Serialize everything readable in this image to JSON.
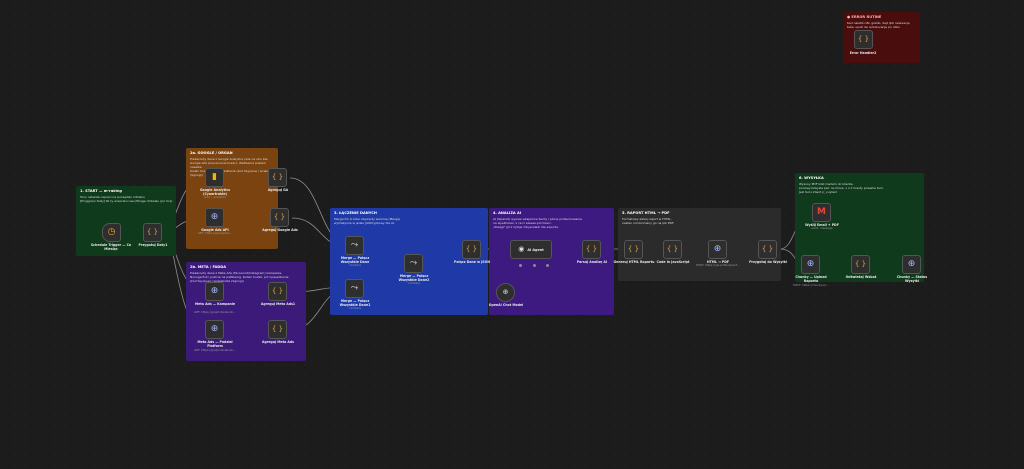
{
  "groups": {
    "error": {
      "title": "● ERROR RUTINE",
      "desc": "Kad naletiš n8n greški, dajt ljidi rešavanje\nteše, uputi da reduzovanje po obliu",
      "color": "#4a0d0d"
    },
    "start": {
      "title": "1. START — m-raking",
      "desc": "Tono rabante capreci na punepdan intrabiu\n[Pruggiran Daty] Pe ty eraecetu neur/Pnege ntrbalau (pri bra)",
      "color": "#0f3a1c"
    },
    "google": {
      "title": "2a. GOOGLE / ORGAN",
      "desc": "Prekarouty dane z Google Analytics (wie na obu bia,\nGoogle Ads (nevuocenie kozac), WabSema (swazic nasalka.\nKodan tvalkó, prt npesedkanie (kod Ssyrpoe) i wrapskreta (Sgnogi)",
      "color": "#7a4310"
    },
    "meta": {
      "title": "2b. META / FADDA",
      "desc": "Prekarouty dane z Meta Ads (Faceocod/Instagram) kampanie,\nNonogerfull i pozicie na pattbemg. Kodan tvalkó, prt npesedkanie\n(kod Ssyrpoe) i wrapskreta (Sgnogi)",
      "color": "#3b1a7a"
    },
    "merge": {
      "title": "3. ŁĄCZENIE DANYCH",
      "desc": "Mergochó lo bibe obywarty waronie (Merge)\nwyzdatycze w jeden JSON gotowy dla AI.",
      "color": "#1f3aa6"
    },
    "ai": {
      "title": "4. ANALIZA AI",
      "desc": "AI (OpenAI) wyowa wzajemne Sonty i plona podsumowanie\nna wyekholex, z ce tr szesse.prz tivarc.\n„Pszegl\" (prz njdoje mbyeraledi ste exports.",
      "color": "#3c1a80"
    },
    "report": {
      "title": "5. RAPORT HTML → PDF",
      "desc": "Formatowy kaleq raport w HTML,\nnastan omdonmany go na plk PDF.",
      "color": "#2b2b2b"
    },
    "send": {
      "title": "6. WYSYŁKA",
      "desc": "Wysvoy PDF kilst mailem do klienta,\nponowymiwysla pat: na Drive, x z z Cresty powwlie tem.\nJezi turio klient jr_vuytenł",
      "color": "#0f3a1c"
    }
  },
  "nodes": {
    "error_handler": {
      "label": "Error Handler2",
      "sub": ""
    },
    "schedule": {
      "label": "Schedule Trigger — Co Miesiąc",
      "sub": ""
    },
    "prep": {
      "label": "Przygotuj Daty1",
      "sub": ""
    },
    "ga": {
      "label": "Google Analytics (Cyaartraide)",
      "sub": "GA4 • analytics"
    },
    "ga_agg": {
      "label": "Agreguj GA",
      "sub": ""
    },
    "gads": {
      "label": "Google Ads API",
      "sub": "GET: https://googleads…"
    },
    "gads_agg": {
      "label": "Agreguj Google Ads",
      "sub": ""
    },
    "meta1": {
      "label": "Meta Ads — Kampanie",
      "sub": "GET: https://graph.facebook…"
    },
    "meta1_agg": {
      "label": "Agreguj Meta Ads1",
      "sub": ""
    },
    "meta2": {
      "label": "Meta Ads — Podział Platform",
      "sub": "GET: https://graph.facebook…"
    },
    "meta2_agg": {
      "label": "Agreguj Meta Ads",
      "sub": ""
    },
    "merge_a": {
      "label": "Merge — Połącz Wszystkie Dane",
      "sub": "combine"
    },
    "merge_b": {
      "label": "Merge — Połącz Wszystkie Dane2",
      "sub": "combine"
    },
    "merge_c": {
      "label": "Merge — Połącz Wszystkie Dane1",
      "sub": "combine"
    },
    "prep_ai": {
      "label": "Połącz Dane w JSON",
      "sub": ""
    },
    "ai_agent": {
      "label": "AI Agent",
      "sub": ""
    },
    "openai": {
      "label": "OpenAI Chat Model",
      "sub": ""
    },
    "parse_ai": {
      "label": "Parsuj Analizę AI",
      "sub": ""
    },
    "html": {
      "label": "Generuj HTML Raportu",
      "sub": ""
    },
    "code": {
      "label": "Code in JavaScript",
      "sub": ""
    },
    "pdf": {
      "label": "HTML → PDF",
      "sub": "POST: https://api.pdfendpoint…"
    },
    "prep_send": {
      "label": "Przygotuj do Wysyłki",
      "sub": ""
    },
    "gmail": {
      "label": "Wyślij Email + PDF",
      "sub": "send: message"
    },
    "up1": {
      "label": "Chunky — Upload Raportu",
      "sub": "POST: https://chunky.io/…"
    },
    "up2": {
      "label": "Odświeżaj Wskaż",
      "sub": ""
    },
    "up3": {
      "label": "Chunky — Status Wysyłki",
      "sub": ""
    }
  },
  "icons": {
    "clock": "◷",
    "braces": "{ }",
    "chart": "▮",
    "globe": "⊕",
    "merge": "⤳",
    "robot": "◉",
    "gmail": "M"
  }
}
